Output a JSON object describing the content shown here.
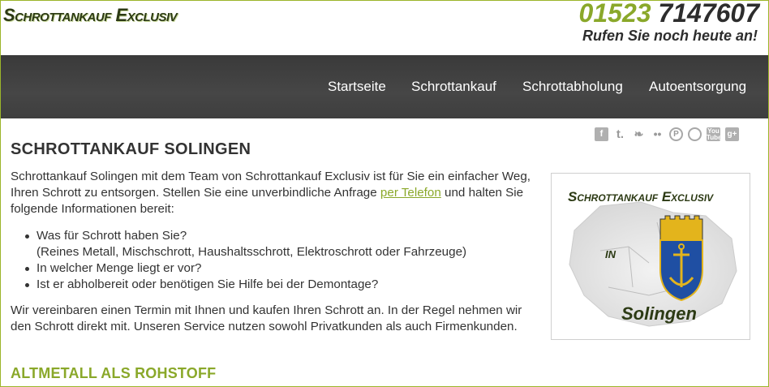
{
  "header": {
    "logo_text": "Schrottankauf Exclusiv",
    "phone_part1": "01523",
    "phone_part2": "7147607",
    "tagline": "Rufen Sie noch heute an!"
  },
  "nav": {
    "items": [
      "Startseite",
      "Schrottankauf",
      "Schrottabholung",
      "Autoentsorgung"
    ]
  },
  "social": [
    "facebook-icon",
    "tumblr-icon",
    "twitter-icon",
    "flickr-icon",
    "pinterest-icon",
    "dribbble-icon",
    "youtube-icon",
    "google-plus-icon"
  ],
  "content": {
    "title": "SCHROTTANKAUF SOLINGEN",
    "intro_before_link": "Schrottankauf Solingen mit dem Team von Schrottankauf Exclusiv ist für Sie ein einfacher Weg, Ihren Schrott zu entsorgen. Stellen Sie eine unverbindliche Anfrage ",
    "intro_link": "per Telefon",
    "intro_after_link": " und halten Sie folgende Informationen bereit:",
    "bullets": [
      "Was für Schrott haben Sie?",
      "(Reines Metall, Mischschrott, Haushaltsschrott, Elektroschrott oder Fahrzeuge)",
      "In welcher Menge liegt er vor?",
      "Ist er abholbereit oder benötigen Sie Hilfe bei der Demontage?"
    ],
    "para2": "Wir vereinbaren einen Termin mit Ihnen und kaufen Ihren Schrott an. In der Regel nehmen wir den Schrott direkt mit. Unseren Service nutzen sowohl Privatkunden als auch Firmenkunden.",
    "section_title": "ALTMETALL ALS ROHSTOFF"
  },
  "image": {
    "logo_line": "Schrottankauf Exclusiv",
    "in_text": "IN",
    "city": "Solingen"
  },
  "colors": {
    "accent_green": "#8aa82a",
    "nav_bg": "#3f3f3f",
    "text": "#333333"
  }
}
